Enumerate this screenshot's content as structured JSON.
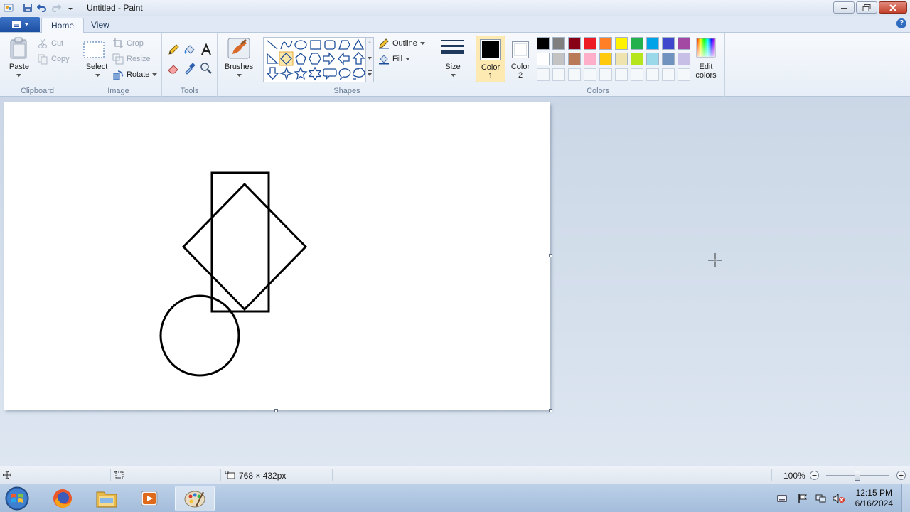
{
  "window": {
    "title": "Untitled - Paint"
  },
  "tabs": {
    "home": "Home",
    "view": "View"
  },
  "clipboard": {
    "paste": "Paste",
    "cut": "Cut",
    "copy": "Copy",
    "group": "Clipboard"
  },
  "image": {
    "select": "Select",
    "crop": "Crop",
    "resize": "Resize",
    "rotate": "Rotate",
    "group": "Image"
  },
  "tools": {
    "group": "Tools"
  },
  "brushes": {
    "label": "Brushes"
  },
  "shapes": {
    "outline": "Outline",
    "fill": "Fill",
    "group": "Shapes"
  },
  "size": {
    "label": "Size"
  },
  "colors": {
    "color1": "Color",
    "color1_num": "1",
    "color2": "Color",
    "color2_num": "2",
    "edit_line1": "Edit",
    "edit_line2": "colors",
    "group": "Colors",
    "color1_value": "#000000",
    "color2_value": "#ffffff",
    "palette_row1": [
      "#000000",
      "#7f7f7f",
      "#880015",
      "#ed1c24",
      "#ff7f27",
      "#fff200",
      "#22b14c",
      "#00a2e8",
      "#3f48cc",
      "#a349a4"
    ],
    "palette_row2": [
      "#ffffff",
      "#c3c3c3",
      "#b97a57",
      "#ffaec9",
      "#ffc90e",
      "#efe4b0",
      "#b5e61d",
      "#99d9ea",
      "#7092be",
      "#c8bfe7"
    ]
  },
  "status": {
    "canvas_size": "768 × 432px",
    "zoom": "100%",
    "zoom_level": 1.0
  },
  "taskbar": {
    "time": "12:15 PM",
    "date": "6/16/2024"
  }
}
